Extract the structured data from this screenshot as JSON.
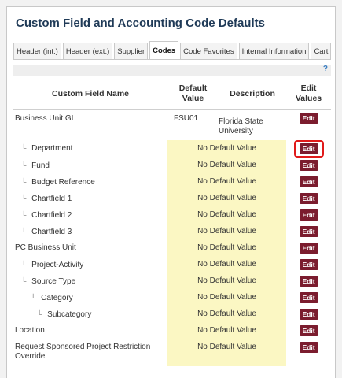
{
  "page": {
    "title": "Custom Field and Accounting Code Defaults"
  },
  "tabs": [
    {
      "label": "Header (int.)"
    },
    {
      "label": "Header (ext.)"
    },
    {
      "label": "Supplier"
    },
    {
      "label": "Codes",
      "active": true
    },
    {
      "label": "Code Favorites"
    },
    {
      "label": "Internal Information"
    },
    {
      "label": "Cart"
    }
  ],
  "help": {
    "label": "?"
  },
  "table": {
    "headers": {
      "name": "Custom Field Name",
      "default": "Default Value",
      "description": "Description",
      "edit": "Edit Values"
    },
    "edit_label": "Edit",
    "rows": [
      {
        "arrow": "",
        "name": "Business Unit GL",
        "default": "FSU01",
        "description": "Florida State University"
      },
      {
        "arrow": "└",
        "name": "Department",
        "default": "No Default Value",
        "description": ""
      },
      {
        "arrow": "└",
        "name": "Fund",
        "default": "No Default Value",
        "description": ""
      },
      {
        "arrow": "└",
        "name": "Budget Reference",
        "default": "No Default Value",
        "description": ""
      },
      {
        "arrow": "└",
        "name": "Chartfield 1",
        "default": "No Default Value",
        "description": ""
      },
      {
        "arrow": "└",
        "name": "Chartfield 2",
        "default": "No Default Value",
        "description": ""
      },
      {
        "arrow": "└",
        "name": "Chartfield 3",
        "default": "No Default Value",
        "description": ""
      },
      {
        "arrow": "",
        "name": "PC Business Unit",
        "default": "No Default Value",
        "description": ""
      },
      {
        "arrow": "└",
        "name": "Project-Activity",
        "default": "No Default Value",
        "description": ""
      },
      {
        "arrow": "└",
        "name": "Source Type",
        "default": "No Default Value",
        "description": ""
      },
      {
        "arrow": "└",
        "name": "Category",
        "default": "No Default Value",
        "description": ""
      },
      {
        "arrow": "└",
        "name": "Subcategory",
        "default": "No Default Value",
        "description": ""
      },
      {
        "arrow": "",
        "name": "Location",
        "default": "No Default Value",
        "description": ""
      },
      {
        "arrow": "",
        "name": "Request Sponsored Project Restriction Override",
        "default": "No Default Value",
        "description": ""
      }
    ]
  },
  "colors": {
    "edit_button": "#7b1c2e",
    "default_highlight": "#fbf7c3",
    "annotation_box": "#e01a1a",
    "title_text": "#1f3a57"
  }
}
